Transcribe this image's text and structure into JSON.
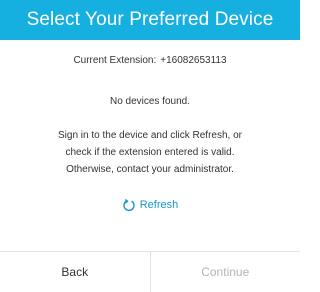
{
  "header": {
    "title": "Select Your Preferred Device"
  },
  "extension": {
    "label": "Current Extension:",
    "value": "+16082653113"
  },
  "status": {
    "message": "No devices found."
  },
  "help": {
    "lines": [
      "Sign in to the device and click Refresh, or",
      "check if the extension entered is valid.",
      "Otherwise, contact your administrator."
    ]
  },
  "refresh": {
    "label": "Refresh",
    "icon": "refresh-icon"
  },
  "footer": {
    "back_label": "Back",
    "continue_label": "Continue"
  },
  "colors": {
    "header_bg": "#15b0e0",
    "accent": "#1895cc",
    "disabled": "#b5b5b5"
  }
}
